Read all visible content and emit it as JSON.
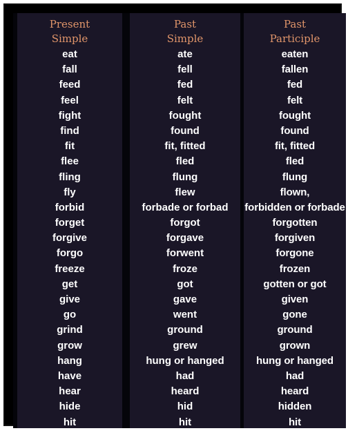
{
  "headers": {
    "present": [
      "Present",
      "Simple"
    ],
    "past": [
      "Past",
      "Simple"
    ],
    "participle": [
      "Past",
      "Participle"
    ]
  },
  "rows": [
    [
      "eat",
      "ate",
      "eaten"
    ],
    [
      "fall",
      "fell",
      "fallen"
    ],
    [
      "feed",
      "fed",
      "fed"
    ],
    [
      "feel",
      "felt",
      "felt"
    ],
    [
      "fight",
      "fought",
      "fought"
    ],
    [
      "find",
      "found",
      "found"
    ],
    [
      "fit",
      "fit, fitted",
      "fit, fitted"
    ],
    [
      "flee",
      "fled",
      "fled"
    ],
    [
      "fling",
      "flung",
      "flung"
    ],
    [
      "fly",
      "flew",
      "flown,"
    ],
    [
      "forbid",
      "forbade or forbad",
      "forbidden or forbade"
    ],
    [
      "forget",
      "forgot",
      "forgotten"
    ],
    [
      "forgive",
      "forgave",
      "forgiven"
    ],
    [
      "forgo",
      "forwent",
      "forgone"
    ],
    [
      "freeze",
      "froze",
      "frozen"
    ],
    [
      "get",
      "got",
      "gotten or got"
    ],
    [
      "give",
      "gave",
      "given"
    ],
    [
      "go",
      "went",
      "gone"
    ],
    [
      "grind",
      "ground",
      "ground"
    ],
    [
      "grow",
      "grew",
      "grown"
    ],
    [
      "hang",
      "hung or hanged",
      "hung or hanged"
    ],
    [
      "have",
      "had",
      "had"
    ],
    [
      "hear",
      "heard",
      "heard"
    ],
    [
      "hide",
      "hid",
      "hidden"
    ],
    [
      "hit",
      "hit",
      "hit"
    ]
  ]
}
